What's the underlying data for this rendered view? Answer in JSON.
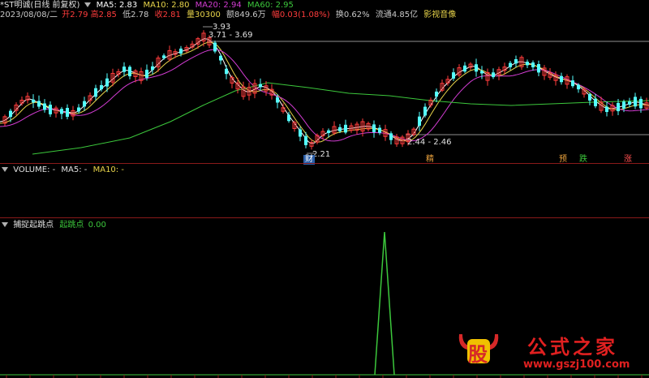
{
  "header": {
    "title": "*ST明诚(日线 前复权)",
    "ma5": "MA5: 2.83",
    "ma10": "MA10: 2.80",
    "ma20": "MA20: 2.94",
    "ma60": "MA60: 2.95",
    "date": "2023/08/08/二",
    "open_label": "开",
    "open": "2.79",
    "high_label": "高",
    "high": "2.85",
    "low_label": "低",
    "low": "2.78",
    "close_label": "收",
    "close": "2.81",
    "vol_label": "量",
    "vol": "30300",
    "amt_label": "额",
    "amt": "849.6万",
    "chg_label": "幅",
    "chg": "0.03(1.08%)",
    "turnover": "换0.62%",
    "float": "流通4.85亿",
    "link": "影视音像"
  },
  "annotations": {
    "high_price": "3.93",
    "range1": "3.71 - 3.69",
    "low_price": "2.21",
    "range2": "2.44 - 2.46"
  },
  "tags": {
    "cai": "财",
    "jing": "精",
    "yu": "预",
    "die": "跌",
    "zhang": "涨"
  },
  "volume_panel": {
    "title": "VOLUME: -",
    "ma5": "MA5: -",
    "ma10": "MA10: -"
  },
  "indicator_panel": {
    "title": "捕捉起跳点",
    "series_label": "起跳点",
    "value": "0.00"
  },
  "watermark": {
    "logo": "股",
    "brand": "公式之家",
    "url": "www.gszj100.com"
  },
  "colors": {
    "up": "#ff3c3c",
    "down": "#54ffff",
    "ma5": "#ffffff",
    "ma10": "#e8d44a",
    "ma20": "#d23cd2",
    "ma60": "#3cc83c",
    "signal": "#3cc83c"
  }
}
